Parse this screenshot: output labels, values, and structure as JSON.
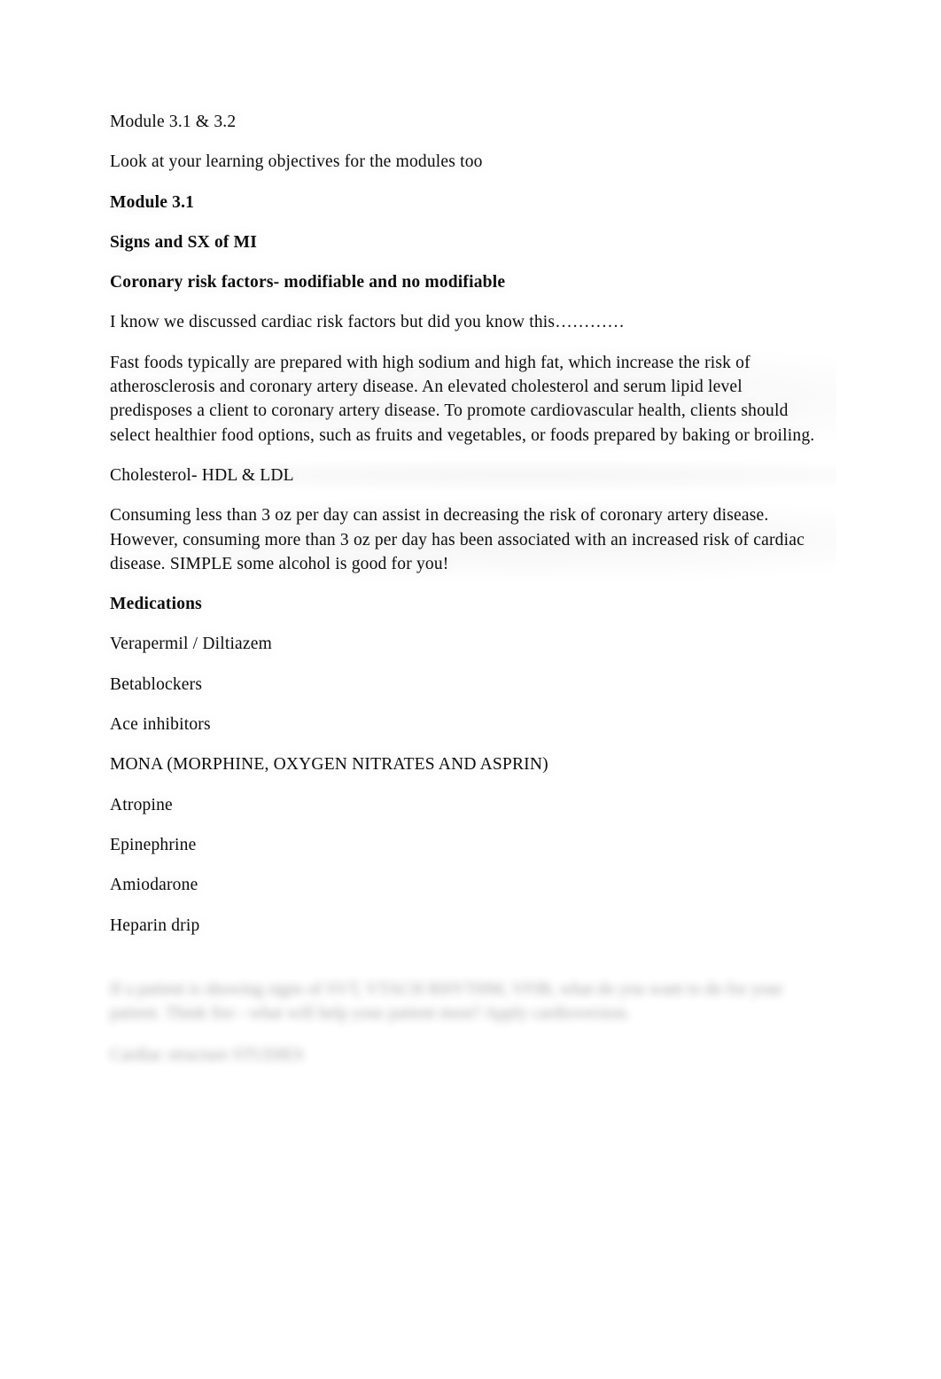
{
  "document": {
    "background_color": "#ffffff",
    "text_color": "#0d0d0d",
    "title_line": "Module 3.1 & 3.2",
    "note_line": "Look at your learning objectives for the modules too",
    "headings": {
      "module": "Module 3.1",
      "signs": "Signs and SX of MI",
      "risk_factors": "Coronary risk factors- modifiable and no modifiable",
      "medications": "Medications"
    },
    "body": {
      "intro": "I know we discussed cardiac risk factors but did you know this…………",
      "fast_foods": " Fast foods typically are prepared with high sodium and high fat, which increase the risk of atherosclerosis and coronary artery disease. An elevated cholesterol and serum lipid level predisposes a client to coronary artery disease. To promote cardiovascular health, clients should select healthier food options, such as fruits and vegetables, or foods prepared by baking or broiling.",
      "cholesterol": "Cholesterol- HDL & LDL",
      "alcohol": "Consuming less than 3 oz per day can assist in decreasing the risk of coronary artery disease. However, consuming more than 3 oz per day has been associated with an increased risk of cardiac disease. SIMPLE some alcohol is good for you!"
    },
    "medications_list": [
      "Verapermil / Diltiazem",
      "Betablockers",
      "Ace inhibitors",
      "MONA (MORPHINE, OXYGEN NITRATES AND ASPRIN)",
      "Atropine",
      "Epinephrine",
      "Amiodarone",
      "Heparin drip"
    ],
    "redacted": {
      "paragraph_one": "If a patient is showing signs of SVT, VTACH RHYTHM, VFIB, what do you want to do for your patient. Think fire - what will help your patient most? Apply cardioversion.",
      "paragraph_two": "Cardiac structure STUDIES"
    }
  }
}
